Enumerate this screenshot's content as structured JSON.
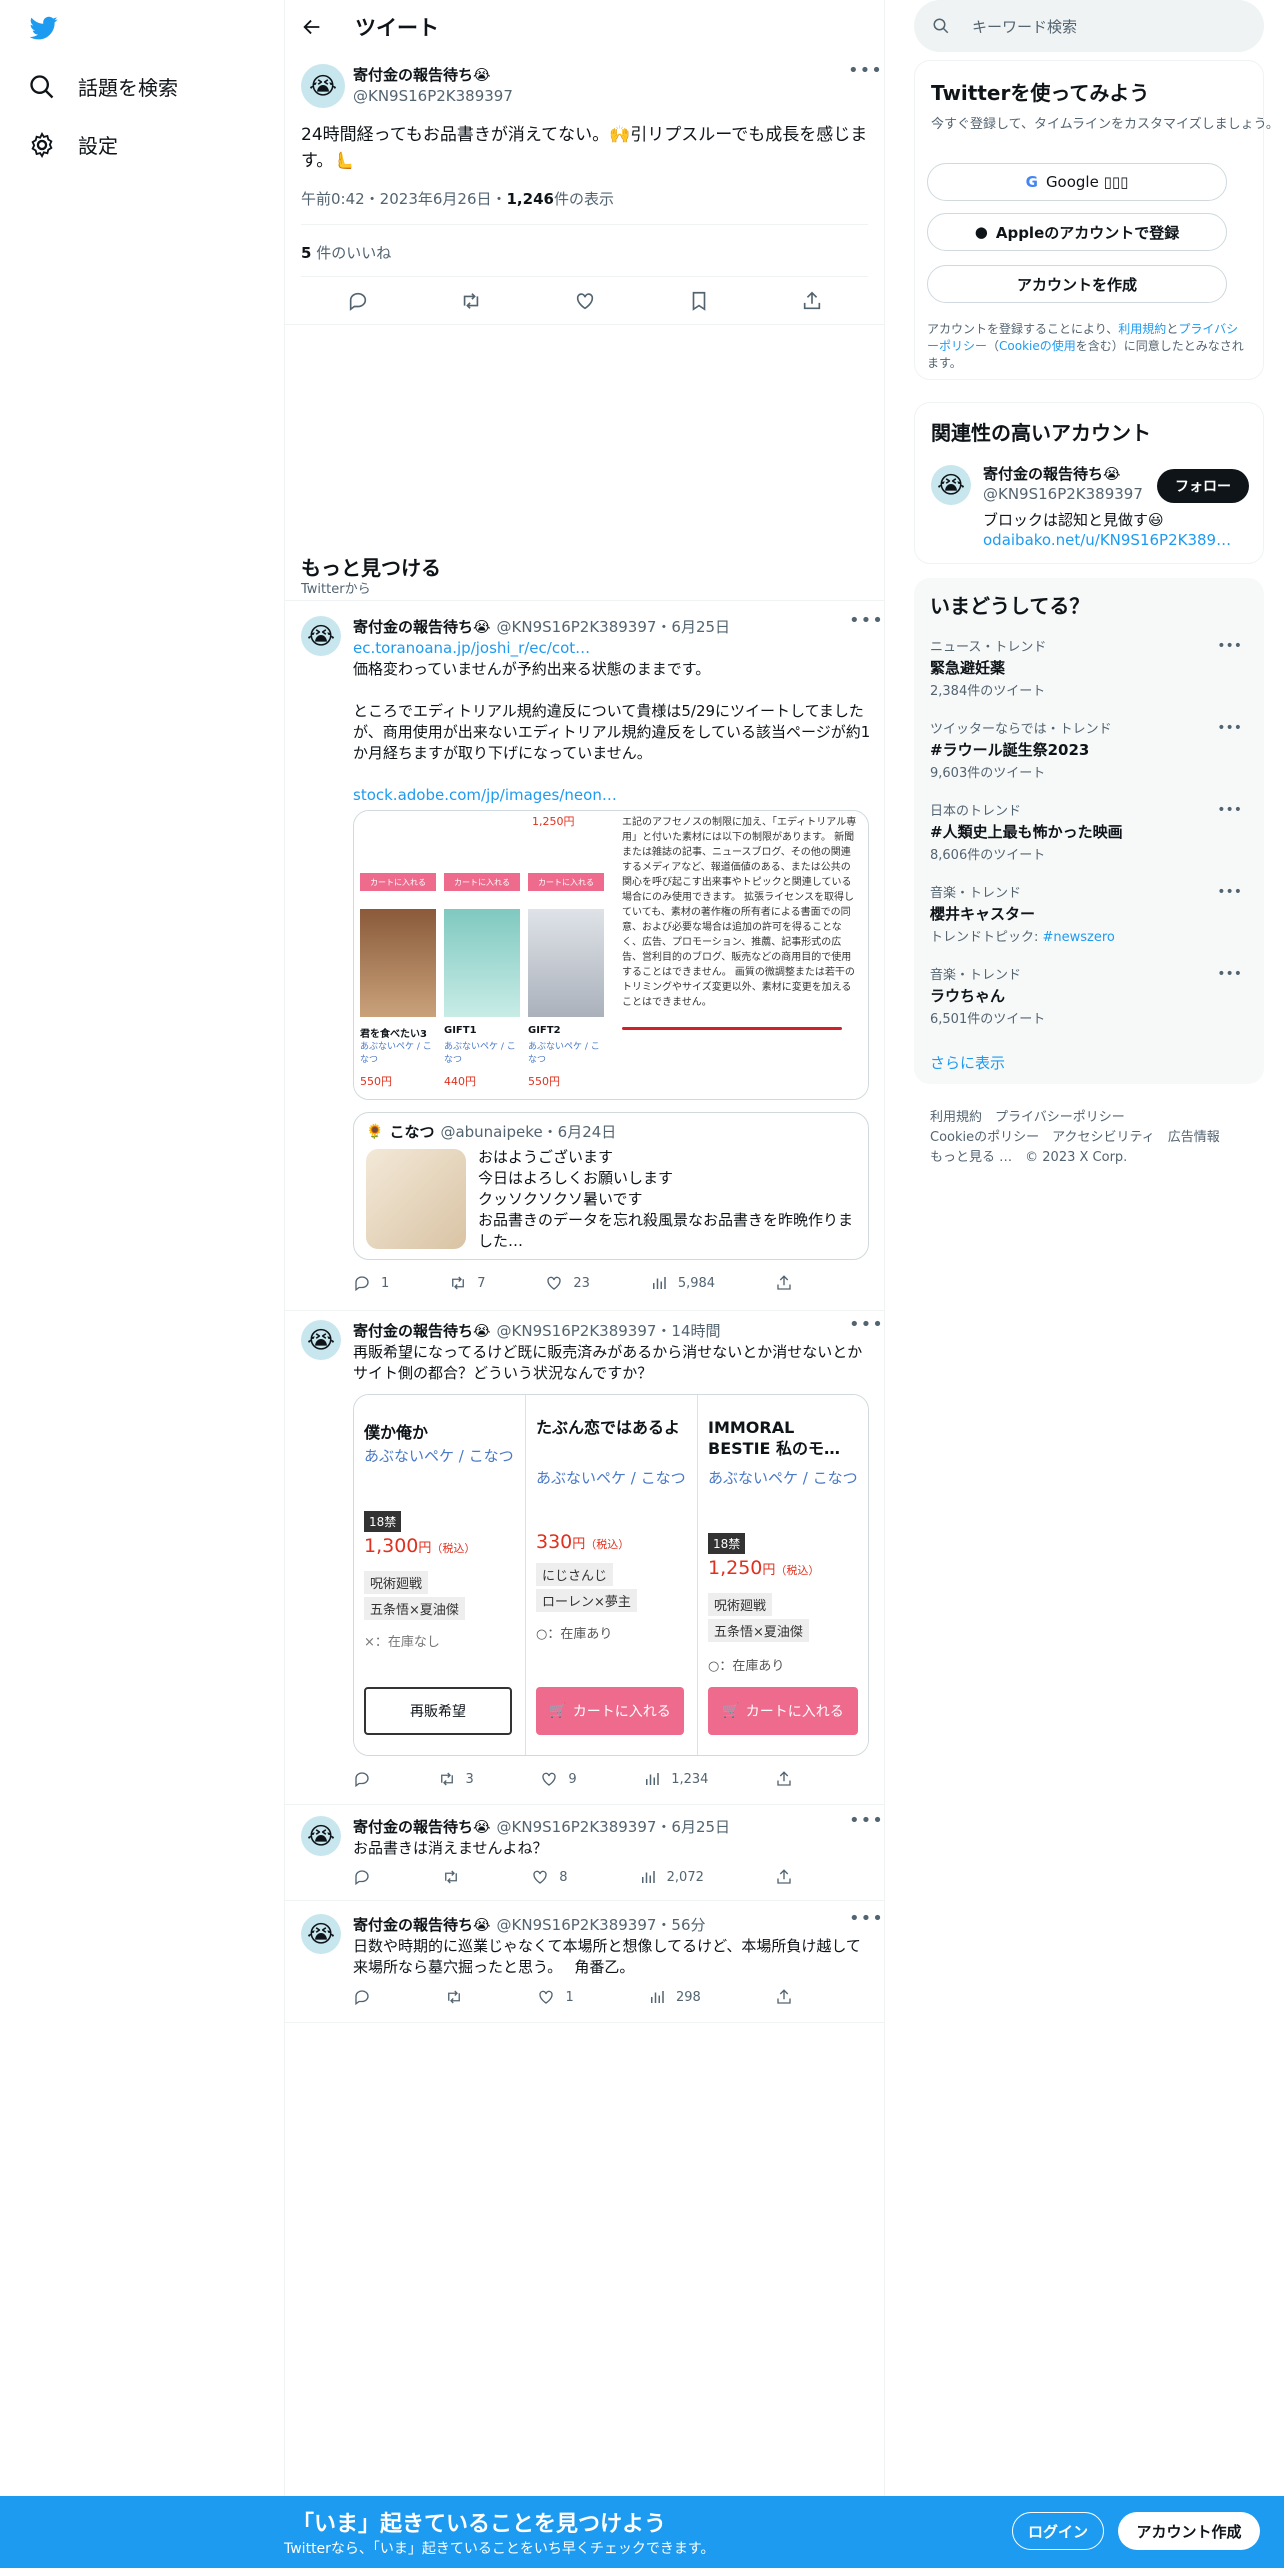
{
  "nav": {
    "explore_label": "話題を検索",
    "settings_label": "設定"
  },
  "header": {
    "title": "ツイート"
  },
  "main_tweet": {
    "name": "寄付金の報告待ち😭",
    "handle": "@KN9S16P2K389397",
    "text_line1": "24時間経ってもお品書きが消えてない。🙌引リプスルーでも成長を感じま",
    "text_line2": "す。🫷",
    "time": "午前0:42・2023年6月26日・",
    "views_count": "1,246",
    "views_label": "件の表示",
    "likes_count": "5",
    "likes_label": "件のいいね"
  },
  "more_section": {
    "title": "もっと見つける",
    "subtitle": "Twitterから"
  },
  "tweet1": {
    "name": "寄付金の報告待ち😭",
    "meta": "@KN9S16P2K389397・6月25日",
    "link1": "ec.toranoana.jp/joshi_r/ec/cot…",
    "line1": "価格変わっていませんが予約出来る状態のままです。",
    "para2": "ところでエディトリアル規約違反について貴様は5/29にツイートしてましたが、商用使用が出来ないエディトリアル規約違反をしている該当ページが約1か月経ちますが取り下げになっていません。",
    "link2": "stock.adobe.com/jp/images/neon…",
    "img_left": {
      "item1": "君を食べたい3",
      "item2": "GIFT1",
      "item3": "GIFT2",
      "author": "あぶないペケ / こなつ",
      "price1": "550円",
      "price2": "440円",
      "price3": "550円",
      "top_price": "1,250円",
      "cart": "カートに入れる"
    },
    "img_right": {
      "text": "エ記のアフセノスの制限に加え、「エディトリアル専用」と付いた素材には以下の制限があります。 新聞または雑誌の記事、ニュースブログ、その他の関連するメディアなど、報道価値のある、または公共の関心を呼び起こす出来事やトピックと関連している場合にのみ使用できます。 拡張ライセンスを取得していても、素材の著作権の所有者による書面での同意、および必要な場合は追加の許可を得ることなく、広告、プロモーション、推薦、記事形式の広告、営利目的のブログ、販売などの商用目的で使用することはできません。 画質の微調整または若干のトリミングやサイズ変更以外、素材に変更を加えることはできません。"
    },
    "quote": {
      "name": "こなつ",
      "meta": "@abunaipeke・6月24日",
      "text": "おはようございます\n今日はよろしくお願いします\nクッソクソクソ暑いです\nお品書きのデータを忘れ殺風景なお品書きを昨晩作りました…"
    },
    "replies": "1",
    "retweets": "7",
    "likes": "23",
    "views": "5,984"
  },
  "tweet2": {
    "name": "寄付金の報告待ち😭",
    "meta": "@KN9S16P2K389397・14時間",
    "text": "再販希望になってるけど既に販売済みがあるから消せないとか消せないとかサイト側の都合？どういう状況なんですか？",
    "col1": {
      "title": "僕か俺か",
      "author": "あぶないペケ / こなつ",
      "tag": "18禁",
      "price": "1,300",
      "yen": "円",
      "tax": "（税込）",
      "chip1": "呪術廻戦",
      "chip2": "五条悟×夏油傑",
      "stock": "×：在庫なし",
      "button": "再販希望"
    },
    "col2": {
      "title": "たぶん恋ではあるよ",
      "author": "あぶないペケ / こなつ",
      "price": "330",
      "yen": "円",
      "tax": "（税込）",
      "chip1": "にじさんじ",
      "chip2": "ローレン×夢主",
      "stock": "○：在庫あり",
      "button": "カートに入れる"
    },
    "col3": {
      "title": "IMMORAL BESTIE 私のモ…",
      "author": "あぶないペケ / こなつ",
      "tag": "18禁",
      "price": "1,250",
      "yen": "円",
      "tax": "（税込）",
      "chip1": "呪術廻戦",
      "chip2": "五条悟×夏油傑",
      "stock": "○：在庫あり",
      "button": "カートに入れる"
    },
    "retweets": "3",
    "likes": "9",
    "views": "1,234"
  },
  "tweet3": {
    "name": "寄付金の報告待ち😭",
    "meta": "@KN9S16P2K389397・6月25日",
    "text": "お品書きは消えませんよね？",
    "likes": "8",
    "views": "2,072"
  },
  "tweet4": {
    "name": "寄付金の報告待ち😭",
    "meta": "@KN9S16P2K389397・56分",
    "text": "日数や時期的に巡業じゃなくて本場所と想像してるけど、本場所負け越して来場所なら墓穴掘ったと思う。　 角番乙。",
    "likes": "1",
    "views": "298"
  },
  "right": {
    "search_placeholder": "キーワード検索",
    "signup": {
      "title": "Twitterを使ってみよう",
      "subtitle": "今すぐ登録して、タイムラインをカスタマイズしましょう。",
      "google": "Google ▯▯▯",
      "apple": "Appleのアカウントで登録",
      "create": "アカウントを作成",
      "legal_prefix": "アカウントを登録することにより、",
      "legal_terms": "利用規約",
      "legal_and": "と",
      "legal_privacy": "プライバシーポリシー",
      "legal_cookie_open": "（",
      "legal_cookie": "Cookieの使用",
      "legal_suffix": "を含む）に同意したとみなされます。"
    },
    "related": {
      "title": "関連性の高いアカウント",
      "name": "寄付金の報告待ち😭",
      "handle": "@KN9S16P2K389397",
      "follow": "フォロー",
      "bio": "ブロックは認知と見做す😃",
      "link": "odaibako.net/u/KN9S16P2K389…"
    },
    "trends": {
      "title": "いまどうしてる？",
      "items": [
        {
          "cat": "ニュース・トレンド",
          "title": "緊急避妊薬",
          "count": "2,384件のツイート"
        },
        {
          "cat": "ツイッターならでは・トレンド",
          "title": "#ラウール誕生祭2023",
          "count": "9,603件のツイート"
        },
        {
          "cat": "日本のトレンド",
          "title": "#人類史上最も怖かった映画",
          "count": "8,606件のツイート"
        },
        {
          "cat": "音楽・トレンド",
          "title": "櫻井キャスター",
          "count_prefix": "トレンドトピック: ",
          "count_link": "#newszero"
        },
        {
          "cat": "音楽・トレンド",
          "title": "ラウちゃん",
          "count": "6,501件のツイート"
        }
      ],
      "more": "さらに表示"
    },
    "footer": {
      "l1a": "利用規約",
      "l1b": "プライバシーポリシー",
      "l2a": "Cookieのポリシー",
      "l2b": "アクセシビリティ",
      "l2c": "広告情報",
      "l3a": "もっと見る …",
      "l3b": "© 2023 X Corp."
    }
  },
  "bottom": {
    "title": "「いま」起きていることを見つけよう",
    "subtitle": "Twitterなら、「いま」起きていることをいち早くチェックできます。",
    "login": "ログイン",
    "signup": "アカウント作成"
  },
  "colors": {
    "accent": "#1d9bf0",
    "text": "#0f1419",
    "muted": "#536471",
    "pink": "#ee6b8d",
    "price_red": "#e0301e"
  }
}
